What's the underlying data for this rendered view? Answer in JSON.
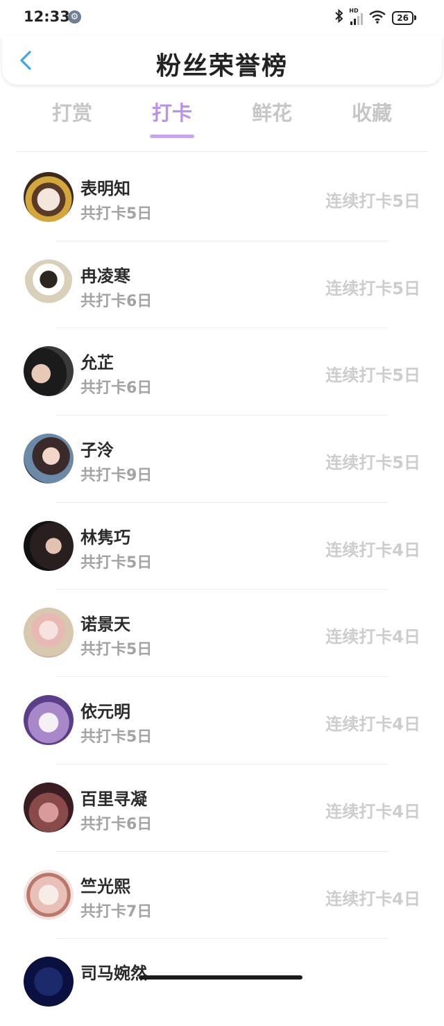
{
  "status_bar": {
    "time": "12:33",
    "battery": "26",
    "network_label": "HD",
    "icons": [
      "gear-icon",
      "bluetooth-icon",
      "signal-icon",
      "wifi-icon",
      "battery-icon"
    ]
  },
  "header": {
    "title": "粉丝荣誉榜",
    "back_icon": "chevron-left-icon",
    "accent_color": "#3aa8e8"
  },
  "tabs": [
    {
      "label": "打赏",
      "active": false
    },
    {
      "label": "打卡",
      "active": true
    },
    {
      "label": "鲜花",
      "active": false
    },
    {
      "label": "收藏",
      "active": false
    }
  ],
  "accent_color": "#b794e6",
  "fans": [
    {
      "name": "表明知",
      "total": "共打卡5日",
      "streak": "连续打卡5日"
    },
    {
      "name": "冉凌寒",
      "total": "共打卡6日",
      "streak": "连续打卡5日"
    },
    {
      "name": "允芷",
      "total": "共打卡6日",
      "streak": "连续打卡5日"
    },
    {
      "name": "子泠",
      "total": "共打卡9日",
      "streak": "连续打卡5日"
    },
    {
      "name": "林隽巧",
      "total": "共打卡5日",
      "streak": "连续打卡4日"
    },
    {
      "name": "诺景天",
      "total": "共打卡5日",
      "streak": "连续打卡4日"
    },
    {
      "name": "依元明",
      "total": "共打卡5日",
      "streak": "连续打卡4日"
    },
    {
      "name": "百里寻凝",
      "total": "共打卡6日",
      "streak": "连续打卡4日"
    },
    {
      "name": "竺光熙",
      "total": "共打卡7日",
      "streak": "连续打卡4日"
    },
    {
      "name": "司马婉然",
      "total": "",
      "streak": ""
    }
  ]
}
